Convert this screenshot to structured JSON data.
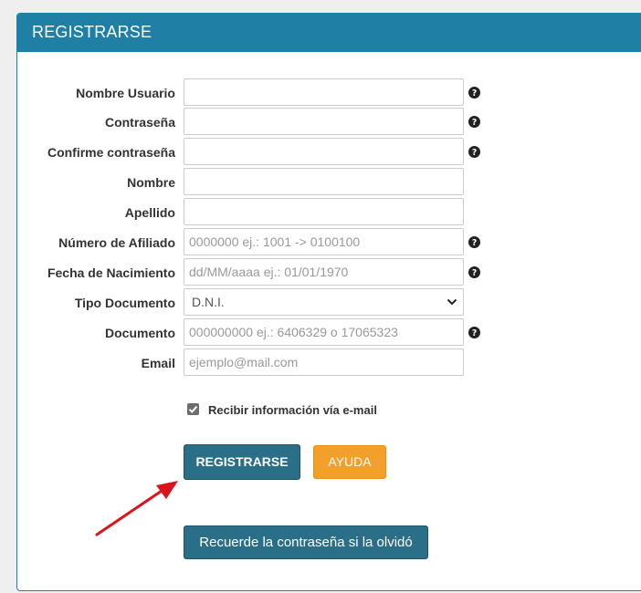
{
  "header": {
    "title": "REGISTRARSE"
  },
  "form": {
    "fields": [
      {
        "label": "Nombre Usuario",
        "value": "",
        "placeholder": "",
        "help": "question-circle-icon"
      },
      {
        "label": "Contraseña",
        "value": "",
        "placeholder": "",
        "help": "question-circle-icon"
      },
      {
        "label": "Confirme contraseña",
        "value": "",
        "placeholder": "",
        "help": "question-circle-icon"
      },
      {
        "label": "Nombre",
        "value": "",
        "placeholder": ""
      },
      {
        "label": "Apellido",
        "value": "",
        "placeholder": ""
      },
      {
        "label": "Número de Afiliado",
        "value": "",
        "placeholder": "0000000 ej.: 1001 -> 0100100",
        "help": "question-circle-icon"
      },
      {
        "label": "Fecha de Nacimiento",
        "value": "",
        "placeholder": "dd/MM/aaaa ej.: 01/01/1970",
        "help": "question-circle-icon"
      },
      {
        "label": "Tipo Documento",
        "selected": "D.N.I."
      },
      {
        "label": "Documento",
        "value": "",
        "placeholder": "000000000 ej.: 6406329 o 17065323",
        "help": "question-circle-icon"
      },
      {
        "label": "Email",
        "value": "",
        "placeholder": "ejemplo@mail.com"
      }
    ],
    "checkbox": {
      "label": "Recibir información vía e-mail",
      "checked": true
    },
    "buttons": {
      "register": "REGISTRARSE",
      "help": "AYUDA",
      "recover": "Recuerde la contraseña si la olvidó"
    }
  },
  "colors": {
    "header": "#1f7fa4",
    "primary_button": "#2a6f87",
    "help_button": "#f3a02b",
    "annotation_arrow": "#d8141c"
  }
}
